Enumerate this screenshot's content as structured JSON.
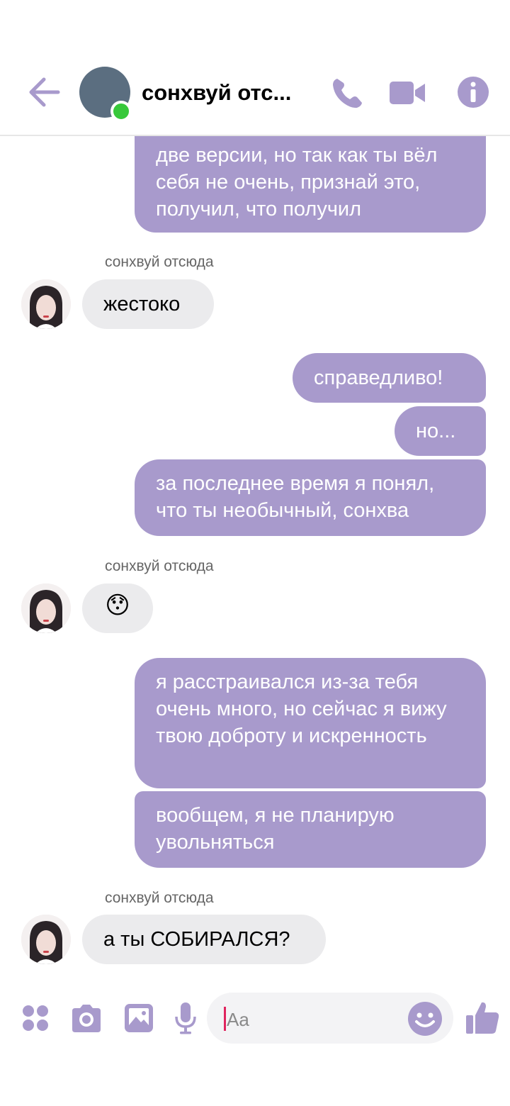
{
  "header": {
    "back_icon": "arrow-left-icon",
    "contact_name": "сонхвуй отс...",
    "online": true,
    "call_icon": "phone-icon",
    "video_icon": "video-camera-icon",
    "info_icon": "info-icon"
  },
  "messages": [
    {
      "direction": "out",
      "text": "две версии, но так как ты вёл себя не очень, признай это, получил, что получил"
    },
    {
      "direction": "in",
      "sender": "сонхвуй отсюда",
      "text": "жестоко"
    },
    {
      "direction": "out",
      "text": "справедливо!"
    },
    {
      "direction": "out",
      "text": "но..."
    },
    {
      "direction": "out",
      "text": "за последнее время я понял, что ты необычный, сонхва"
    },
    {
      "direction": "in",
      "sender": "сонхвуй отсюда",
      "text": "😯"
    },
    {
      "direction": "out",
      "text": "я расстраивался из-за тебя очень много, но сейчас я вижу твою доброту и искренность"
    },
    {
      "direction": "out",
      "text": "вообщем, я не планирую увольняться"
    },
    {
      "direction": "in",
      "sender": "сонхвуй отсюда",
      "text": "а ты СОБИРАЛСЯ?"
    }
  ],
  "composer": {
    "apps_icon": "grid-dots-icon",
    "camera_icon": "camera-icon",
    "gallery_icon": "image-icon",
    "mic_icon": "microphone-icon",
    "placeholder": "Aa",
    "emoji_icon": "smiley-icon",
    "like_icon": "thumbs-up-icon"
  },
  "colors": {
    "accent": "#a89acc",
    "incoming_bubble": "#ebebed",
    "online": "#37c83a"
  }
}
